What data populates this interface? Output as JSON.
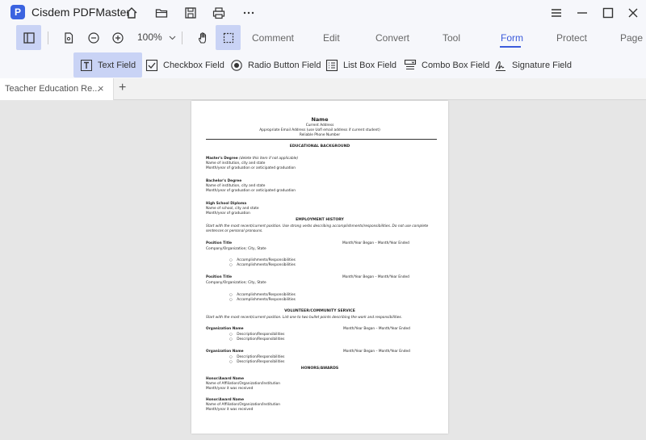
{
  "app": {
    "logo_letter": "P",
    "title": "Cisdem PDFMaster"
  },
  "toolbar": {
    "zoom": "100%",
    "menu_tabs": [
      "Comment",
      "Edit",
      "Convert",
      "Tool",
      "Form",
      "Protect",
      "Page"
    ],
    "active_tab": "Form"
  },
  "formbar": {
    "fields": [
      "Text Field",
      "Checkbox Field",
      "Radio Button Field",
      "List Box Field",
      "Combo Box Field",
      "Signature Field"
    ],
    "active": "Text Field"
  },
  "tabs": {
    "doc_tab": "Teacher Education Re...",
    "close": "×",
    "add": "+"
  },
  "document": {
    "name": "Name",
    "address": "Current Address",
    "email": "Appropriate Email Address (use UofI email address if current student)",
    "phone": "Reliable Phone Number",
    "edu_heading": "EDUCATIONAL BACKGROUND",
    "masters_title": "Master's Degree",
    "masters_note": "(delete this item if not applicable)",
    "masters_line1": "Name of institution, city and state",
    "masters_line2": "Month/year of graduation or anticipated graduation",
    "bachelors_title": "Bachelor's Degree",
    "bachelors_line1": "Name of institution, city and state",
    "bachelors_line2": "Month/year of graduation or anticipated graduation",
    "hs_title": "High School Diploma",
    "hs_line1": "Name of school, city and state",
    "hs_line2": "Month/year of graduation",
    "emp_heading": "EMPLOYMENT HISTORY",
    "emp_intro1": "Start with the most recent/current position. Use strong verbs describing accomplishments/responsibilities. Do not use complete",
    "emp_intro2": "sentences or personal pronouns.",
    "pos1_title": "Position Title",
    "pos1_dates": "Month/Year Began – Month/Year Ended",
    "pos1_company": "Company/Organization; City, State",
    "pos1_b1": "Accomplishments/Responsibilities",
    "pos1_b2": "Accomplishments/Responsibilities",
    "pos2_title": "Position Title",
    "pos2_dates": "Month/Year Began – Month/Year Ended",
    "pos2_company": "Company/Organization; City, State",
    "pos2_b1": "Accomplishments/Responsibilities",
    "pos2_b2": "Accomplishments/Responsibilities",
    "vol_heading": "VOLUNTEER/COMMUNITY SERVICE",
    "vol_intro": "Start with the most recent/current position. List one to two bullet points describing the work and responsibilities.",
    "org1_title": "Organization Name",
    "org1_dates": "Month/Year Began – Month/Year Ended",
    "org1_b1": "Description/Responsibilities",
    "org1_b2": "Description/Responsibilities",
    "org2_title": "Organization Name",
    "org2_dates": "Month/Year Began – Month/Year Ended",
    "org2_b1": "Description/Responsibilities",
    "org2_b2": "Description/Responsibilities",
    "honors_heading": "HONORS/AWARDS",
    "award1_title": "Honor/Award Name",
    "award1_line1": "Name of Affiliation/Organization/Institution",
    "award1_line2": "Month/year it was received",
    "award2_title": "Honor/Award Name",
    "award2_line1": "Name of Affiliation/Organization/Institution",
    "award2_line2": "Month/year it was received"
  },
  "colors": {
    "accent": "#3b5bdb",
    "active_bg": "#c9d3f5",
    "chrome": "#f6f7fb",
    "canvas": "#e6e6e6"
  }
}
